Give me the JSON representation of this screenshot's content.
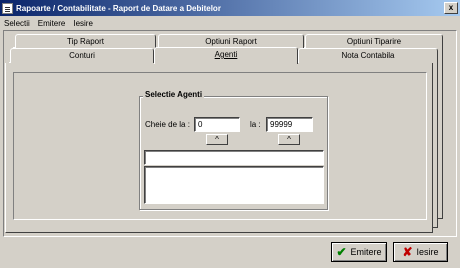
{
  "window": {
    "title": "Rapoarte / Contabilitate - Raport de Datare a Debitelor",
    "close_glyph": "x"
  },
  "menu": [
    "Selectii",
    "Emitere",
    "Iesire"
  ],
  "tabs": {
    "back_row": [
      "Tip Raport",
      "Optiuni Raport",
      "Optiuni Tiparire"
    ],
    "front_row": [
      "Conturi",
      "Agenti",
      "Nota Contabila"
    ],
    "active": "Agenti"
  },
  "agent_selection": {
    "group_title": "Selectie Agenti",
    "from_label": "Cheie  de la :",
    "from_value": "0",
    "to_label": "la :",
    "to_value": "99999",
    "arrow_glyph": "^",
    "list_header_value": "",
    "list_items": []
  },
  "buttons": {
    "emit_label": "Emitere",
    "exit_label": "Iesire",
    "emit_icon": "checkmark-icon",
    "exit_icon": "x-icon"
  },
  "colors": {
    "title_gradient_start": "#0a246a",
    "title_gradient_end": "#a6caf0",
    "face": "#d4d0c8",
    "ok_green": "#008000",
    "exit_red": "#c00000"
  }
}
